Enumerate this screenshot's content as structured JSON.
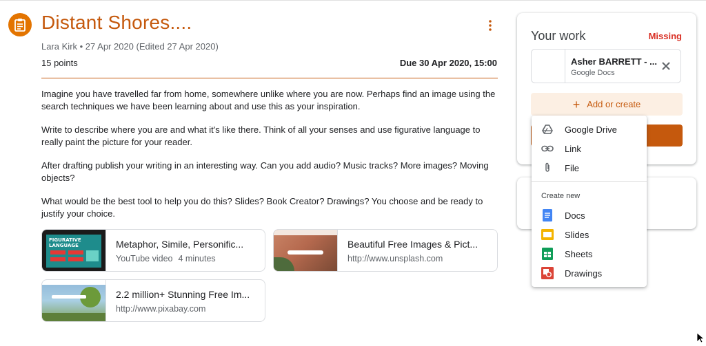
{
  "assignment": {
    "title": "Distant Shores....",
    "meta": "Lara Kirk • 27 Apr 2020 (Edited 27 Apr 2020)",
    "points": "15 points",
    "due": "Due 30 Apr 2020, 15:00",
    "instructions": [
      "Imagine you have travelled far from home, somewhere unlike where you are now. Perhaps find an image using the search techniques we have been learning about and use this as your inspiration.",
      "Write to describe where you are and what it's like there. Think of all your senses and use figurative language to really paint the picture for your reader.",
      "After drafting publish your writing in an interesting way. Can you add audio? Music tracks? More images? Moving objects?",
      "What would be the best tool to help you do this? Slides? Book Creator? Drawings? You choose and be ready to justify your choice."
    ],
    "attachments": [
      {
        "title": "Metaphor, Simile, Personific...",
        "sub1": "YouTube video",
        "sub2": "4 minutes",
        "thumb_text": "FIGURATIVE LANGUAGE"
      },
      {
        "title": "Beautiful Free Images & Pict...",
        "sub1": "http://www.unsplash.com"
      },
      {
        "title": "2.2 million+ Stunning Free Im...",
        "sub1": "http://www.pixabay.com"
      }
    ]
  },
  "your_work": {
    "title": "Your work",
    "status": "Missing",
    "file": {
      "name": "Asher BARRETT - ...",
      "type": "Google Docs"
    },
    "add_label": "Add or create"
  },
  "menu": {
    "items": [
      "Google Drive",
      "Link",
      "File"
    ],
    "create_header": "Create new",
    "create_items": [
      "Docs",
      "Slides",
      "Sheets",
      "Drawings"
    ]
  },
  "colors": {
    "accent": "#c5590d",
    "missing": "#d93025",
    "docs": "#4285f4",
    "slides": "#f4b400",
    "sheets": "#0f9d58",
    "drawings": "#db4437"
  }
}
